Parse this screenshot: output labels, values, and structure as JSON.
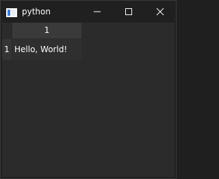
{
  "window": {
    "title": "python",
    "app_icon": "window-app-icon",
    "controls": {
      "minimize_icon": "minimize-icon",
      "maximize_icon": "maximize-icon",
      "close_icon": "close-icon"
    }
  },
  "table": {
    "column_headers": [
      "1"
    ],
    "row_headers": [
      "1"
    ],
    "cells": [
      [
        "Hello, World!"
      ]
    ]
  },
  "colors": {
    "titlebar_bg": "#202020",
    "client_bg": "#2b2b2b",
    "header_bg": "#3a3a3a",
    "text": "#ffffff"
  }
}
